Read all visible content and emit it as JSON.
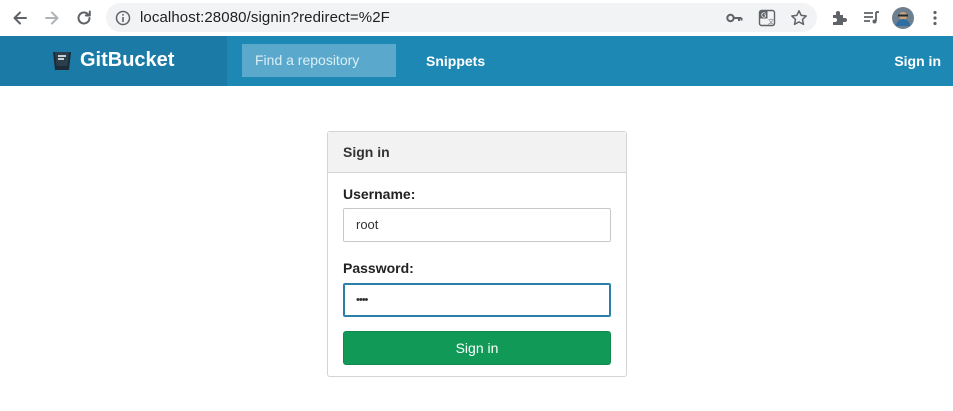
{
  "browser": {
    "url": "localhost:28080/signin?redirect=%2F"
  },
  "header": {
    "brand": "GitBucket",
    "search_placeholder": "Find a repository",
    "snippets_label": "Snippets",
    "signin_label": "Sign in"
  },
  "signin_form": {
    "title": "Sign in",
    "username_label": "Username:",
    "username_value": "root",
    "password_label": "Password:",
    "password_value": "••••",
    "submit_label": "Sign in"
  },
  "colors": {
    "header_bg": "#1e88b5",
    "brand_bg": "#1b7ba6",
    "submit_bg": "#119a57"
  }
}
